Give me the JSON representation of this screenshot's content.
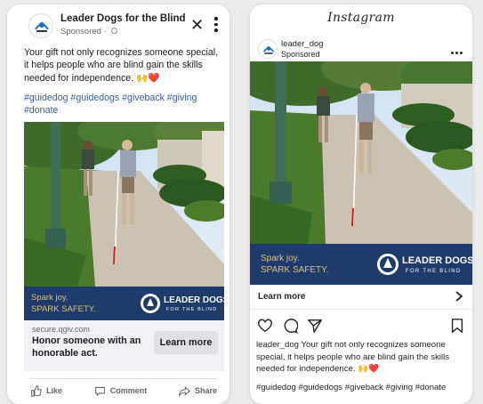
{
  "facebook": {
    "page_name": "Leader Dogs for the Blind",
    "sponsored": "Sponsored · ",
    "post_text": "Your gift not only recognizes someone special, it helps people who are blind gain the skills needed for independence. 🙌❤️",
    "hashtags": "#guidedog #guidedogs #giveback #giving #donate",
    "banner": {
      "line1": "Spark joy.",
      "line2": "SPARK SAFETY.",
      "logo_line1": "LEADER DOGS",
      "logo_line2": "FOR THE BLIND"
    },
    "cta": {
      "domain": "secure.qgiv.com",
      "headline": "Honor someone with an honorable act.",
      "button": "Learn more"
    },
    "actions": {
      "like": "Like",
      "comment": "Comment",
      "share": "Share"
    }
  },
  "instagram": {
    "app_title": "Instagram",
    "username": "leader_dog",
    "sponsored": "Sponsored",
    "learn_more": "Learn more",
    "caption_user": "leader_dog",
    "caption_text": " Your gift not only recognizes someone special, it helps people who are blind gain the skills needed for independence. 🙌❤️",
    "hashtags": "#guidedog #guidedogs #giveback #giving #donate",
    "banner": {
      "line1": "Spark joy.",
      "line2": "SPARK SAFETY.",
      "logo_line1": "LEADER DOGS",
      "logo_line2": "FOR THE BLIND"
    }
  },
  "colors": {
    "banner_navy": "#1f3a6b",
    "banner_text_gold": "#d9c27a",
    "fb_link_blue": "#3b5b99"
  },
  "icons": [
    "globe-icon",
    "close-icon",
    "more-options-icon",
    "like-icon",
    "comment-icon",
    "share-icon",
    "heart-icon",
    "comment-bubble-icon",
    "send-icon",
    "bookmark-icon",
    "chevron-right-icon",
    "leader-dogs-logo"
  ]
}
